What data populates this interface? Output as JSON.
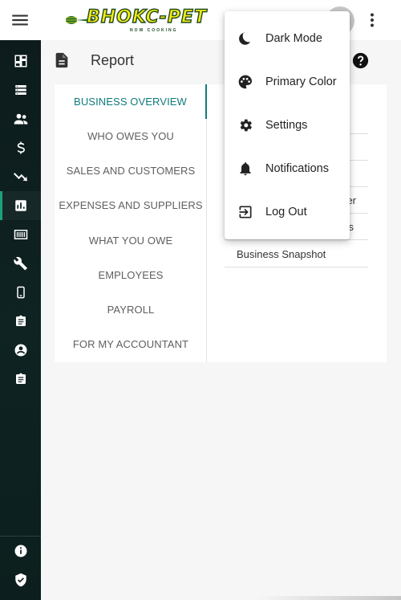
{
  "app": {
    "logo_text": "BHOKC-PET",
    "logo_subtitle": "NOW COOKING"
  },
  "header": {
    "title": "Report"
  },
  "categories": [
    {
      "label": "BUSINESS OVERVIEW",
      "active": true
    },
    {
      "label": "WHO OWES YOU",
      "active": false
    },
    {
      "label": "SALES AND CUSTOMERS",
      "active": false
    },
    {
      "label": "EXPENSES AND SUPPLIERS",
      "active": false
    },
    {
      "label": "WHAT YOU OWE",
      "active": false
    },
    {
      "label": "EMPLOYEES",
      "active": false
    },
    {
      "label": "PAYROLL",
      "active": false
    },
    {
      "label": "FOR MY ACCOUNTANT",
      "active": false
    }
  ],
  "reports": [
    {
      "label": ""
    },
    {
      "label": ""
    },
    {
      "label": ""
    },
    {
      "label": "er"
    },
    {
      "label": "s"
    },
    {
      "label": "Business Snapshot"
    }
  ],
  "menu": {
    "items": [
      {
        "label": "Dark Mode",
        "icon": "moon-icon"
      },
      {
        "label": "Primary Color",
        "icon": "palette-icon"
      },
      {
        "label": "Settings",
        "icon": "gear-icon"
      },
      {
        "label": "Notifications",
        "icon": "bell-icon"
      },
      {
        "label": "Log Out",
        "icon": "logout-icon"
      }
    ]
  },
  "sidebar": {
    "items": [
      {
        "icon": "dashboard-icon"
      },
      {
        "icon": "list-icon"
      },
      {
        "icon": "people-icon"
      },
      {
        "icon": "dollar-icon"
      },
      {
        "icon": "trending-down-icon"
      },
      {
        "icon": "bar-chart-icon",
        "active": true
      },
      {
        "icon": "barcode-icon"
      },
      {
        "icon": "wrench-icon"
      },
      {
        "icon": "phone-icon"
      },
      {
        "icon": "clipboard-icon"
      },
      {
        "icon": "account-icon"
      },
      {
        "icon": "clipboard-icon"
      }
    ],
    "bottom_items": [
      {
        "icon": "info-icon"
      },
      {
        "icon": "shield-check-icon"
      }
    ]
  },
  "colors": {
    "accent": "#117a7a",
    "sidebar_bg": "#0e2322",
    "active_indicator": "#1aa37a"
  }
}
